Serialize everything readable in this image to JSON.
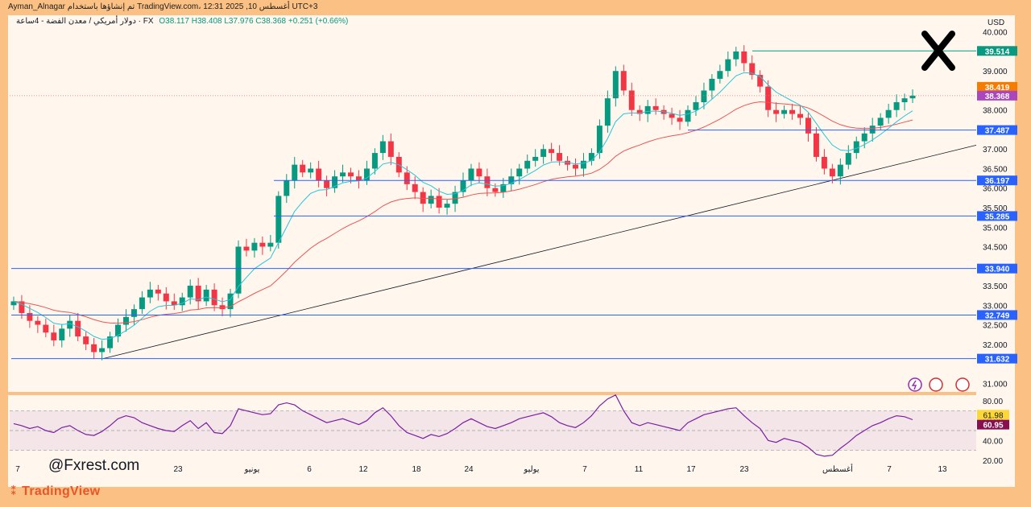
{
  "header": {
    "top_line": "Ayman_Alnagar تم إنشاؤها باستخدام TradingView.com، 12:31 2025 ,10 أغسطس UTC+3",
    "symbol_line": "دولار أمريكي / معدن الفضة - 4ساعة · FX",
    "o": "O38.117",
    "h": "H38.408",
    "l": "L37.976",
    "c": "C38.368",
    "chg": "+0.251 (+0.66%)"
  },
  "currency": "USD",
  "watermark": "@Fxrest.com",
  "brand": "TradingView",
  "logo": "x-logo-icon",
  "colors": {
    "background": "#fbc184",
    "panel": "#fff7ee",
    "candle_up": "#089981",
    "candle_down": "#f23645",
    "level_line": "#2962ff",
    "ema_fast": "#26c6da",
    "ema_slow": "#ef5350",
    "trendline": "#131722",
    "high_line": "#089981"
  },
  "chart_data": [
    {
      "type": "candlestick",
      "title": "",
      "ylabel": "USD",
      "ylim": [
        30.8,
        40.2
      ],
      "y_ticks": [
        31.0,
        31.5,
        32.0,
        32.5,
        33.0,
        33.5,
        34.0,
        34.5,
        35.0,
        35.5,
        36.0,
        36.5,
        37.0,
        37.5,
        38.0,
        38.5,
        39.0,
        39.5,
        40.0
      ],
      "x_ticks": [
        "7",
        "23",
        "يونيو",
        "6",
        "12",
        "18",
        "24",
        "يوليو",
        "7",
        "11",
        "17",
        "23",
        "أغسطس",
        "7",
        "13"
      ],
      "closes": [
        33.1,
        32.8,
        32.6,
        32.5,
        32.3,
        32.1,
        32.4,
        32.6,
        32.2,
        32.0,
        31.8,
        31.9,
        32.2,
        32.5,
        32.7,
        32.9,
        33.2,
        33.4,
        33.3,
        33.1,
        33.0,
        33.2,
        33.5,
        33.1,
        33.4,
        33.0,
        32.9,
        33.3,
        34.5,
        34.4,
        34.6,
        34.5,
        34.6,
        35.8,
        36.2,
        36.6,
        36.4,
        36.5,
        36.2,
        36.0,
        36.3,
        36.4,
        36.3,
        36.2,
        36.5,
        36.9,
        37.2,
        36.8,
        36.4,
        36.1,
        35.9,
        35.6,
        35.8,
        35.5,
        35.6,
        35.9,
        36.2,
        36.5,
        36.3,
        36.0,
        35.9,
        36.1,
        36.3,
        36.5,
        36.7,
        36.8,
        37.0,
        36.9,
        36.7,
        36.6,
        36.5,
        36.7,
        36.9,
        37.6,
        38.3,
        39.0,
        38.5,
        38.0,
        37.9,
        38.1,
        38.0,
        37.9,
        37.8,
        37.7,
        38.0,
        38.2,
        38.5,
        38.8,
        39.0,
        39.3,
        39.5,
        39.2,
        38.9,
        38.6,
        38.0,
        37.9,
        38.0,
        37.9,
        37.8,
        37.4,
        36.8,
        36.5,
        36.3,
        36.6,
        36.9,
        37.2,
        37.4,
        37.6,
        37.8,
        38.0,
        38.2,
        38.3,
        38.368
      ],
      "ema_fast_label": "EMA fast (cyan)",
      "ema_slow_label": "EMA slow (red)",
      "current_price": 38.368,
      "current_price_label": "38.368",
      "ask_price_label": "38.419",
      "levels": [
        {
          "value": 39.514,
          "label": "39.514",
          "color": "#089981"
        },
        {
          "value": 37.487,
          "label": "37.487",
          "color": "#2962ff"
        },
        {
          "value": 36.197,
          "label": "36.197",
          "color": "#2962ff"
        },
        {
          "value": 35.285,
          "label": "35.285",
          "color": "#2962ff"
        },
        {
          "value": 33.94,
          "label": "33.940",
          "color": "#2962ff"
        },
        {
          "value": 32.749,
          "label": "32.749",
          "color": "#2962ff"
        },
        {
          "value": 31.632,
          "label": "31.632",
          "color": "#2962ff"
        }
      ],
      "trendline": {
        "start": 31.632,
        "end": 37.1
      }
    },
    {
      "type": "line",
      "title": "",
      "ylim": [
        15,
        85
      ],
      "y_ticks": [
        20.0,
        40.0,
        60.0,
        80.0
      ],
      "y_tick_labels": [
        "20.00",
        "40.00",
        "60.00",
        "80.00"
      ],
      "band": [
        30,
        70
      ],
      "rsi_value_label": "60.95",
      "rsi_ma_label": "61.98",
      "values": [
        57,
        55,
        52,
        54,
        50,
        48,
        53,
        55,
        50,
        46,
        45,
        49,
        55,
        62,
        65,
        63,
        58,
        55,
        52,
        50,
        49,
        55,
        60,
        52,
        58,
        48,
        47,
        55,
        72,
        70,
        68,
        66,
        67,
        76,
        78,
        76,
        70,
        66,
        62,
        58,
        60,
        62,
        59,
        56,
        60,
        68,
        73,
        65,
        55,
        48,
        45,
        42,
        46,
        44,
        47,
        52,
        58,
        62,
        58,
        54,
        52,
        55,
        58,
        62,
        64,
        66,
        68,
        64,
        58,
        55,
        53,
        58,
        65,
        75,
        82,
        86,
        70,
        58,
        55,
        58,
        56,
        54,
        52,
        50,
        58,
        62,
        66,
        68,
        70,
        72,
        73,
        65,
        58,
        52,
        40,
        38,
        42,
        40,
        38,
        33,
        26,
        24,
        25,
        32,
        38,
        45,
        50,
        55,
        58,
        62,
        65,
        64,
        60.95
      ]
    }
  ]
}
